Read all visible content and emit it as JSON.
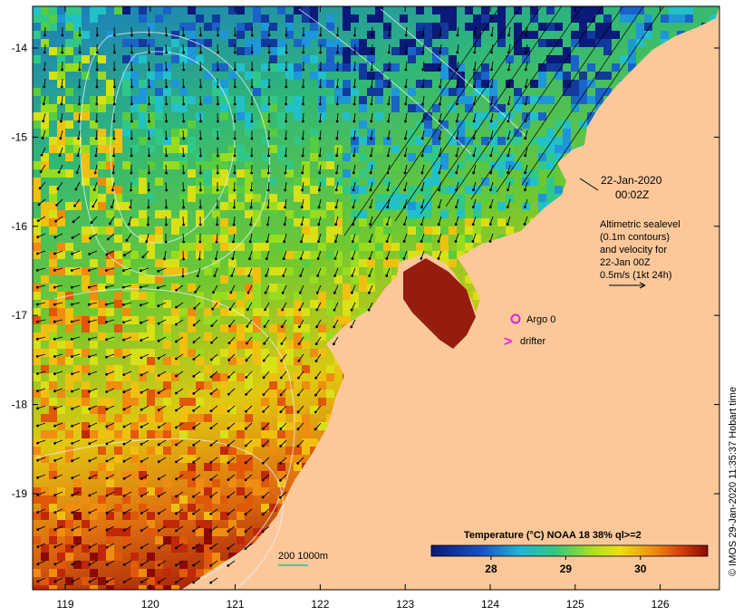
{
  "map": {
    "date": "22-Jan-2020",
    "time": "00:02Z",
    "altimetry_lines": [
      "Altimetric sealevel",
      "(0.1m contours)",
      "and velocity for",
      "22-Jan 00Z",
      "0.5m/s (1kt 24h)"
    ],
    "legend": {
      "argo_label": "Argo 0",
      "drifter_symbol": ">",
      "drifter_label": "drifter"
    },
    "scale_label": "200  1000m",
    "colorbar": {
      "title": "Temperature (°C) NOAA 18 38% ql>=2",
      "ticks": [
        "28",
        "29",
        "30"
      ],
      "range": [
        27.2,
        30.9
      ]
    },
    "credit": "© IMOS 29-Jan-2020 11:35:37 Hobart time",
    "x_ticks": [
      "119",
      "120",
      "121",
      "122",
      "123",
      "124",
      "125",
      "126"
    ],
    "y_ticks": [
      "-14",
      "-15",
      "-16",
      "-17",
      "-18",
      "-19"
    ],
    "colors": {
      "land": "#fcc89a",
      "cold": "#0d2a8a",
      "warm": "#8a0a00",
      "argo": "#e020e0",
      "contour": "#e8f4ff",
      "scale_line": "#22c4a0"
    }
  }
}
